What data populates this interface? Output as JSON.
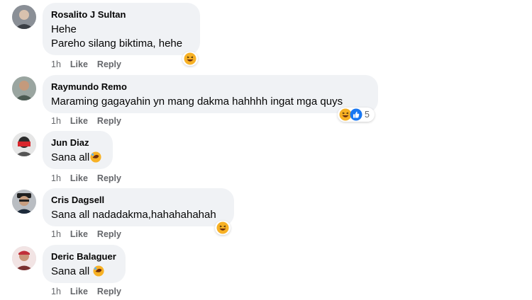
{
  "comments": [
    {
      "author": "Rosalito J Sultan",
      "lines": [
        "Hehe",
        "Pareho silang biktima, hehe"
      ],
      "time": "1h",
      "like": "Like",
      "reply": "Reply",
      "reactions": [
        "haha-icon"
      ],
      "reaction_count": ""
    },
    {
      "author": "Raymundo Remo",
      "lines": [
        "Maraming gagayahin yn mang dakma hahhhh ingat mga quys"
      ],
      "time": "1h",
      "like": "Like",
      "reply": "Reply",
      "reactions": [
        "haha-icon",
        "like-icon"
      ],
      "reaction_count": "5"
    },
    {
      "author": "Jun Diaz",
      "lines": [
        "Sana all"
      ],
      "inline_emoji": "rofl-icon",
      "time": "1h",
      "like": "Like",
      "reply": "Reply"
    },
    {
      "author": "Cris Dagsell",
      "lines": [
        "Sana all nadadakma,hahahahahah"
      ],
      "time": "1h",
      "like": "Like",
      "reply": "Reply",
      "reactions": [
        "haha-icon"
      ],
      "reaction_count": ""
    },
    {
      "author": "Deric Balaguer",
      "lines": [
        "Sana all "
      ],
      "inline_emoji": "rofl-icon",
      "time": "1h",
      "like": "Like",
      "reply": "Reply"
    }
  ],
  "colors": {
    "bubble": "#f0f2f5",
    "meta_text": "#65676b",
    "like_blue": "#1877f2",
    "haha_yellow": "#f7b125"
  }
}
